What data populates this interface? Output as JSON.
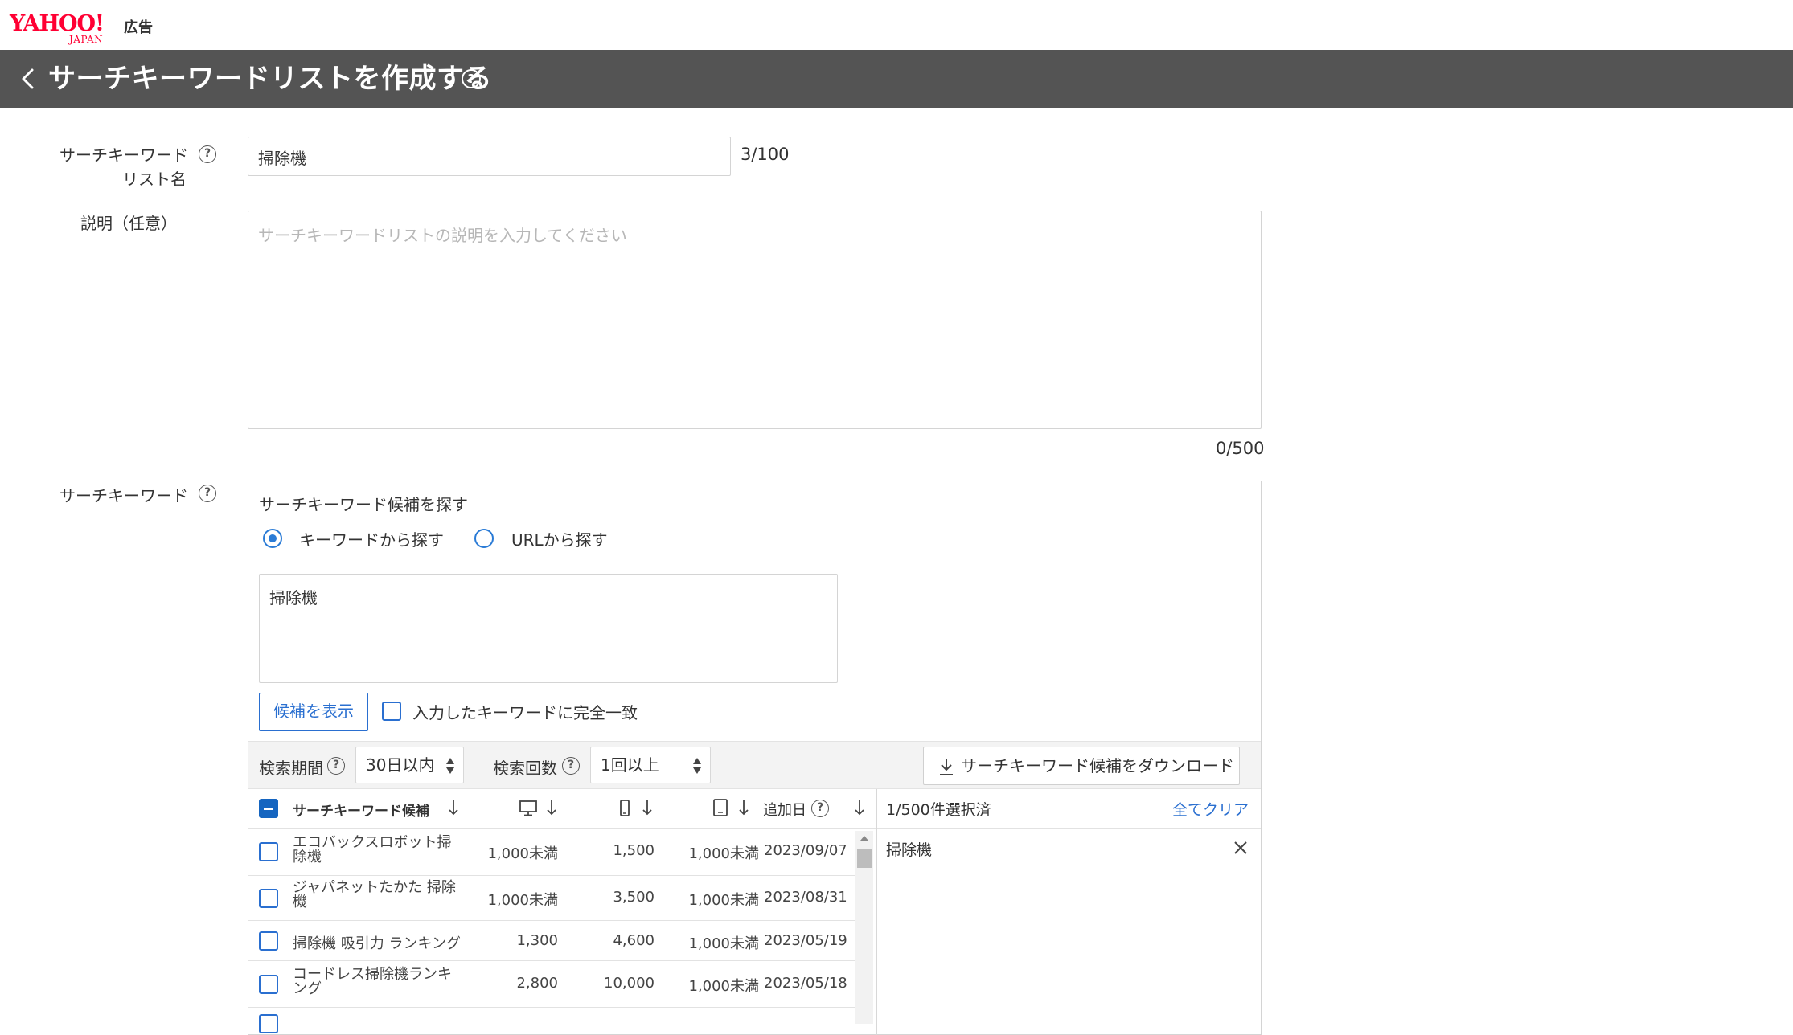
{
  "brand": {
    "logo_main": "YAHOO!",
    "logo_sub": "JAPAN",
    "product": "広告",
    "accent_red": "#ff0033"
  },
  "header": {
    "title": "サーチキーワードリストを作成する",
    "bg": "#545454"
  },
  "form": {
    "list_name_label_line1": "サーチキーワード",
    "list_name_label_line2": "リスト名",
    "list_name_value": "掃除機",
    "list_name_counter": "3/100",
    "description_label": "説明（任意）",
    "description_placeholder": "サーチキーワードリストの説明を入力してください",
    "description_counter": "0/500",
    "keywords_label": "サーチキーワード"
  },
  "finder": {
    "heading": "サーチキーワード候補を探す",
    "radio_keyword": "キーワードから探す",
    "radio_url": "URLから探す",
    "radio_selected": "keyword",
    "keyword_input_value": "掃除機",
    "show_button": "候補を表示",
    "exact_match_label": "入力したキーワードに完全一致",
    "link_color": "#2a6fd0"
  },
  "filters": {
    "period_label": "検索期間",
    "period_value": "30日以内",
    "count_label": "検索回数",
    "count_value": "1回以上",
    "download_button": "サーチキーワード候補をダウンロード"
  },
  "table": {
    "col_keyword": "サーチキーワード候補",
    "col_added": "追加日",
    "rows": [
      {
        "keyword": "エコバックスロボット掃除機",
        "pc": "1,000未満",
        "mobile": "1,500",
        "tablet": "1,000未満",
        "date": "2023/09/07"
      },
      {
        "keyword": "ジャパネットたかた 掃除機",
        "pc": "1,000未満",
        "mobile": "3,500",
        "tablet": "1,000未満",
        "date": "2023/08/31"
      },
      {
        "keyword": "掃除機 吸引力 ランキング",
        "pc": "1,300",
        "mobile": "4,600",
        "tablet": "1,000未満",
        "date": "2023/05/19"
      },
      {
        "keyword": "コードレス掃除機ランキング",
        "pc": "2,800",
        "mobile": "10,000",
        "tablet": "1,000未満",
        "date": "2023/05/18"
      }
    ]
  },
  "selected": {
    "count_text": "1/500件選択済",
    "clear_all": "全てクリア",
    "items": [
      "掃除機"
    ]
  }
}
